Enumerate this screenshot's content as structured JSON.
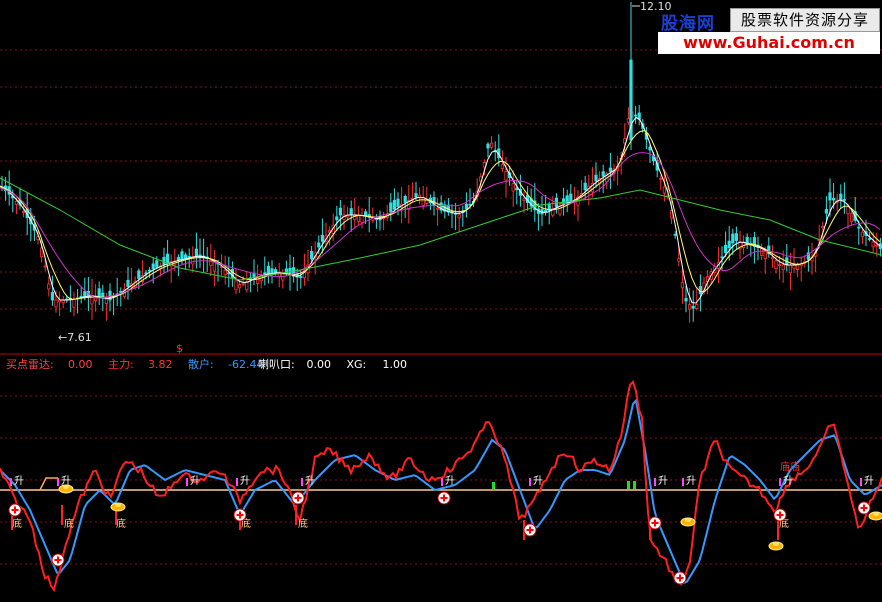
{
  "watermark": {
    "brand": "股海网",
    "slogan": "股票软件资源分享",
    "url": "www.Guhai.com.cn"
  },
  "chart_data": [
    {
      "type": "candlestick",
      "panel": "price",
      "grid": "horizontal dashed red",
      "annotations": {
        "low_label": "←7.61",
        "high_label": "12.10"
      },
      "ma_colors": {
        "ma_fast": "#ffffff",
        "ma_mid": "#ffff66",
        "ma_slow": "#cc33cc",
        "ma_long": "#33cc33"
      }
    },
    {
      "type": "line",
      "panel": "indicator",
      "legend": [
        {
          "label": "买点雷达: ",
          "value": "0.00",
          "color": "#ff4444"
        },
        {
          "label": "主力: ",
          "value": "3.82",
          "color": "#ff3333"
        },
        {
          "label": "散户: ",
          "value": "-62.44",
          "color": "#3399ff"
        },
        {
          "label": "喇叭口: ",
          "value": "0.00",
          "color": "#ffffff"
        },
        {
          "label": "XG: ",
          "value": "1.00",
          "color": "#ffffff"
        }
      ],
      "signal_text": {
        "rise": "升",
        "bottom": "底",
        "dollar": "$",
        "flag": "庙"
      },
      "series": [
        {
          "name": "主力",
          "color": "#ff2020"
        },
        {
          "name": "散户",
          "color": "#3399ff"
        },
        {
          "color": "#ffcc88"
        }
      ]
    }
  ]
}
